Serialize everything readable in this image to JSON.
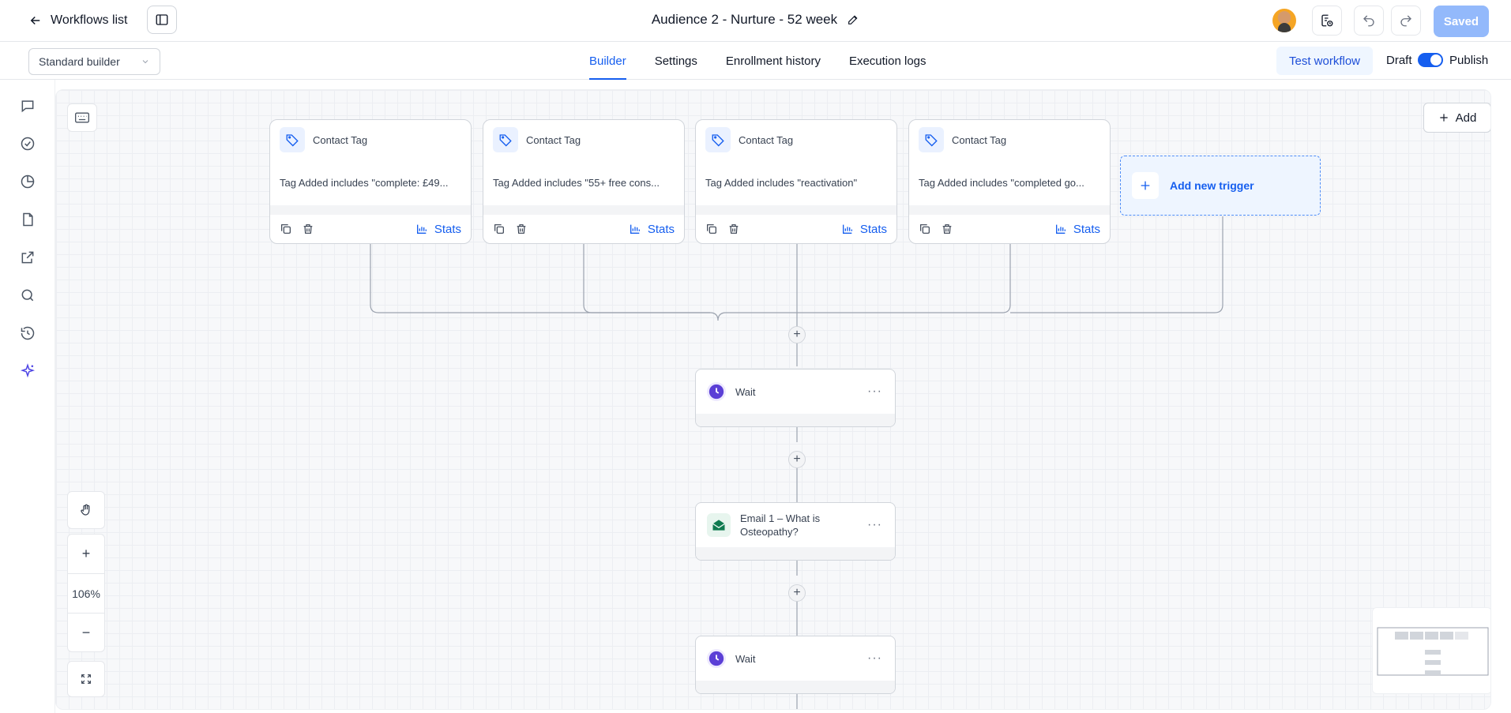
{
  "header": {
    "back_label": "Workflows list",
    "title": "Audience 2 - Nurture - 52 week",
    "saved_label": "Saved"
  },
  "subbar": {
    "builder_select": "Standard builder",
    "tabs": [
      {
        "label": "Builder",
        "active": true
      },
      {
        "label": "Settings",
        "active": false
      },
      {
        "label": "Enrollment history",
        "active": false
      },
      {
        "label": "Execution logs",
        "active": false
      }
    ],
    "test_workflow_label": "Test workflow",
    "draft_label": "Draft",
    "publish_label": "Publish",
    "publish_toggle_on": true
  },
  "sidebar": {
    "icons": [
      "chat-icon",
      "check-circle-icon",
      "pie-chart-icon",
      "file-icon",
      "external-link-icon",
      "search-icon",
      "history-icon",
      "sparkle-icon"
    ]
  },
  "canvas": {
    "add_label": "Add",
    "triggers": [
      {
        "title": "Contact Tag",
        "description": "Tag Added includes \"complete: £49...",
        "stats_label": "Stats"
      },
      {
        "title": "Contact Tag",
        "description": "Tag Added includes \"55+ free cons...",
        "stats_label": "Stats"
      },
      {
        "title": "Contact Tag",
        "description": "Tag Added includes \"reactivation\"",
        "stats_label": "Stats"
      },
      {
        "title": "Contact Tag",
        "description": "Tag Added includes \"completed go...",
        "stats_label": "Stats"
      }
    ],
    "add_trigger_label": "Add new trigger",
    "actions": [
      {
        "label": "Wait",
        "type": "wait"
      },
      {
        "label": "Email 1 – What is Osteopathy?",
        "type": "email"
      },
      {
        "label": "Wait",
        "type": "wait"
      }
    ],
    "zoom_level": "106%"
  },
  "colors": {
    "accent": "#155eef",
    "wait_icon": "#5b3fd6",
    "email_icon": "#0e7a4f"
  }
}
